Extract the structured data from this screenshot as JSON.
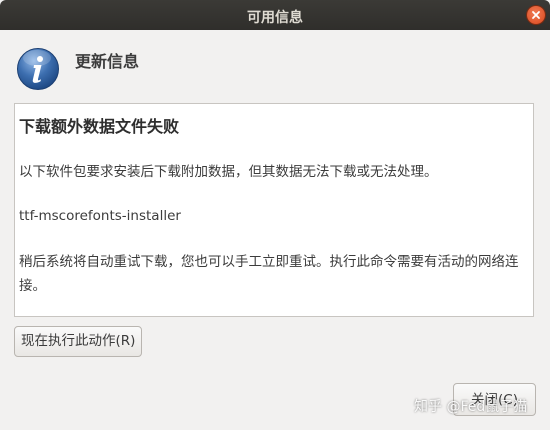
{
  "window": {
    "title": "可用信息"
  },
  "header": {
    "title": "更新信息",
    "icon": "info-icon"
  },
  "content": {
    "heading": "下载额外数据文件失败",
    "paragraph1": "以下软件包要求安装后下载附加数据，但其数据无法下载或无法处理。",
    "package_name": "ttf-mscorefonts-installer",
    "paragraph2": "稍后系统将自动重试下载，您也可以手工立即重试。执行此命令需要有活动的网络连接。"
  },
  "buttons": {
    "run_now_label": "现在执行此动作(R)",
    "close_label": "关闭(C)"
  },
  "watermark": "知乎 @Fed鼠子猫",
  "colors": {
    "titlebar": "#3b3a36",
    "close_button": "#e95420",
    "window_bg": "#f2f1f0",
    "info_icon": "#3d6fb0"
  }
}
